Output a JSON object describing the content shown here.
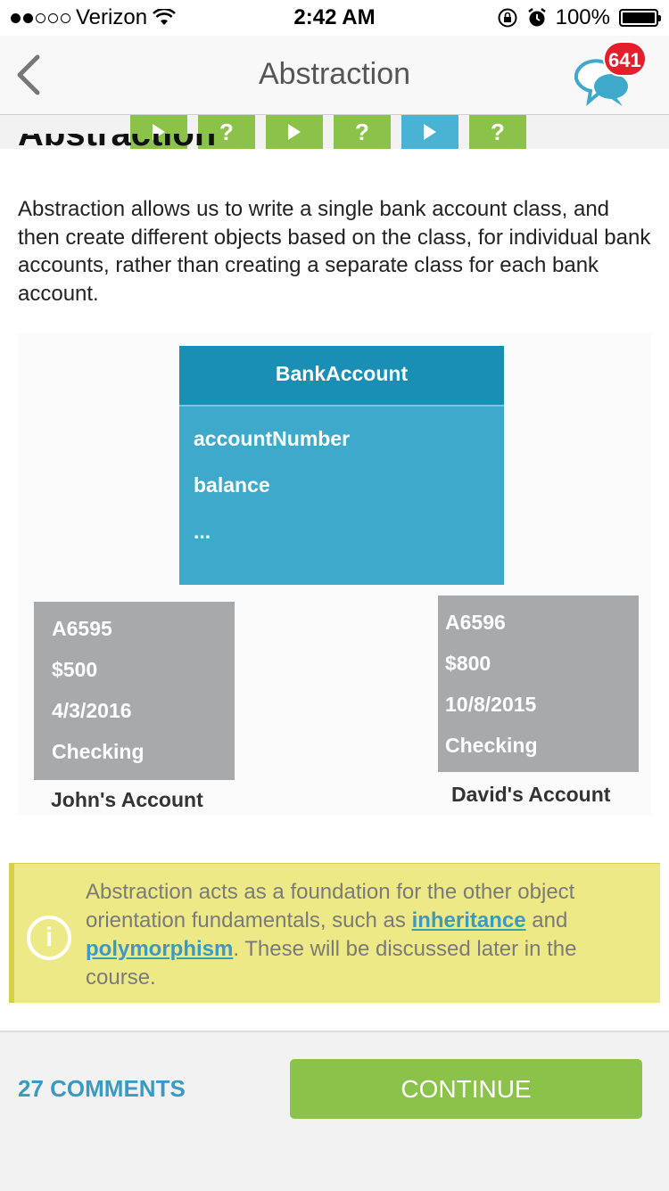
{
  "status_bar": {
    "carrier": "Verizon",
    "time": "2:42 AM",
    "battery": "100%",
    "signal_bars_filled": 2,
    "signal_bars_total": 5
  },
  "nav": {
    "title": "Abstraction",
    "badge_count": "641"
  },
  "steps": [
    {
      "type": "play-icon",
      "label": "",
      "color": "#8bc34a"
    },
    {
      "type": "question",
      "label": "?",
      "color": "#8bc34a"
    },
    {
      "type": "play-icon",
      "label": "",
      "color": "#8bc34a"
    },
    {
      "type": "question",
      "label": "?",
      "color": "#8bc34a"
    },
    {
      "type": "play-icon",
      "label": "",
      "color": "#4ab3d3",
      "current": true
    },
    {
      "type": "question",
      "label": "?",
      "color": "#8bc34a"
    }
  ],
  "content": {
    "clipped_heading": "Abstraction",
    "paragraph": "Abstraction allows us to write a single bank account class, and then create different objects based on the class, for individual bank accounts, rather than creating a separate class for each bank account."
  },
  "diagram": {
    "class_name": "BankAccount",
    "attributes": [
      "accountNumber",
      "balance",
      "..."
    ],
    "objects": [
      {
        "lines": [
          "A6595",
          "$500",
          "4/3/2016",
          "Checking"
        ],
        "caption": "John's Account"
      },
      {
        "lines": [
          "A6596",
          "$800",
          "10/8/2015",
          "Checking"
        ],
        "caption": "David's Account"
      }
    ]
  },
  "info": {
    "icon_glyph": "i",
    "text_part1": "Abstraction acts as a foundation for the other object orientation fundamentals, such as ",
    "link1": "inheritance",
    "text_part2": " and ",
    "link2": "polymorphism",
    "text_part3": ". These will be discussed later in the course."
  },
  "footer": {
    "comments_label": "27 COMMENTS",
    "continue_label": "CONTINUE"
  },
  "colors": {
    "accent_green": "#8bc34a",
    "accent_blue": "#3a9ac4",
    "badge_red": "#e41e2b"
  }
}
